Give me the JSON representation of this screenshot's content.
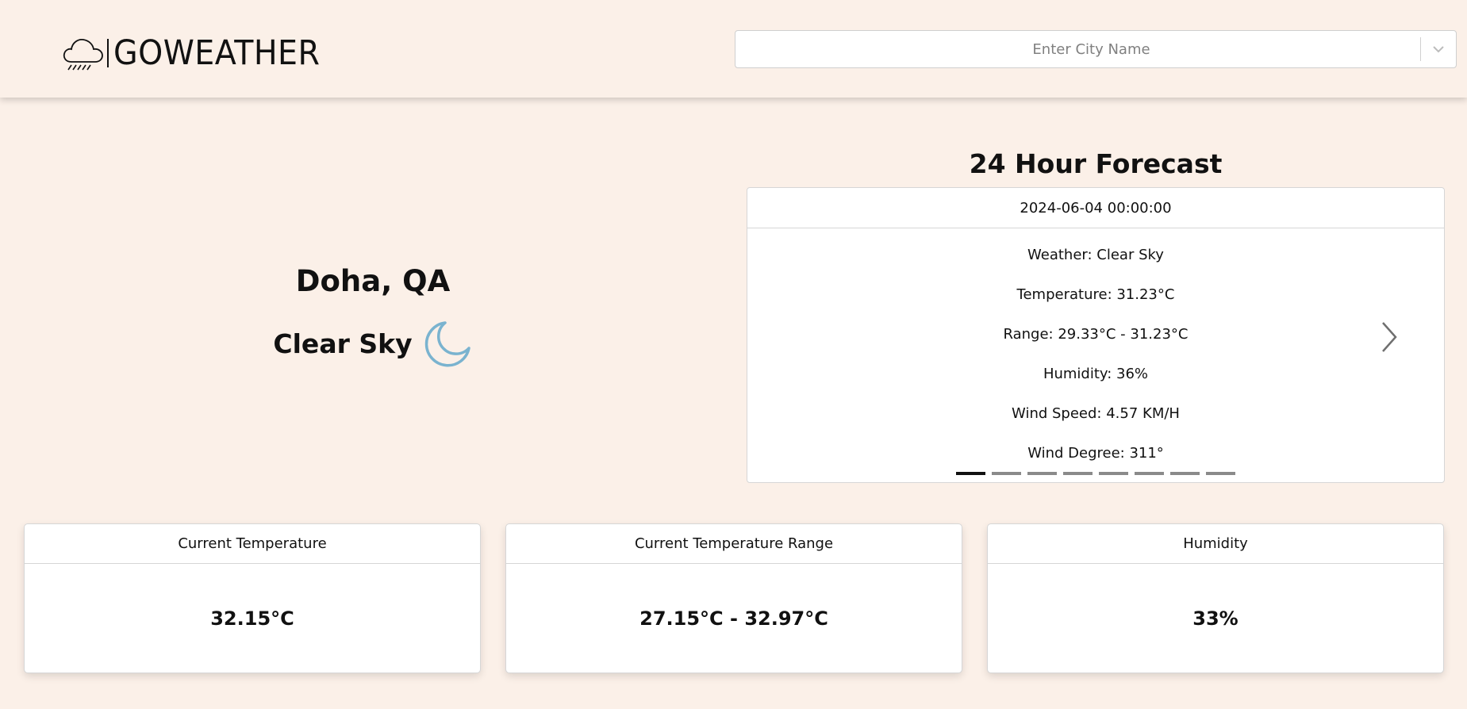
{
  "header": {
    "brand": "GOWEATHER",
    "search": {
      "placeholder": "Enter City Name",
      "value": ""
    }
  },
  "location": {
    "city": "Doha, QA",
    "condition": "Clear Sky",
    "condition_icon": "moon-icon"
  },
  "forecast": {
    "title": "24 Hour Forecast",
    "date": "2024-06-04 00:00:00",
    "lines": [
      "Weather: Clear Sky",
      "Temperature: 31.23°C",
      "Range: 29.33°C - 31.23°C",
      "Humidity: 36%",
      "Wind Speed: 4.57 KM/H",
      "Wind Degree: 311°"
    ],
    "slide_count": 8,
    "active_slide": 1
  },
  "stats": [
    {
      "label": "Current Temperature",
      "value": "32.15°C"
    },
    {
      "label": "Current Temperature Range",
      "value": "27.15°C - 32.97°C"
    },
    {
      "label": "Humidity",
      "value": "33%"
    }
  ],
  "colors": {
    "background": "#fbf0e8",
    "moon_icon": "#7ab3cf",
    "indicator_active": "#111111",
    "indicator_inactive": "#8a8a8a"
  }
}
